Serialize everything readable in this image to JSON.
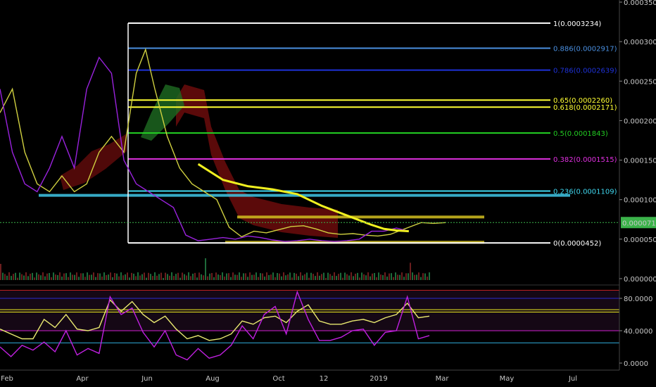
{
  "chart_data": [
    {
      "type": "line",
      "title": "",
      "xlabel": "",
      "ylabel": "",
      "x_ticks": [
        "Feb",
        "Apr",
        "Jun",
        "Aug",
        "Oct",
        "12",
        "2019",
        "Mar",
        "May",
        "Jul"
      ],
      "y_ticks": [
        "0.0000000",
        "0.0000500",
        "0.0001000",
        "0.0001500",
        "0.0002000",
        "0.0002500",
        "0.0003000",
        "0.0003500"
      ],
      "ylim": [
        0,
        0.00035
      ],
      "grid": false,
      "last_price": {
        "label": "0.0000710",
        "value": 7.1e-05,
        "color": "#3bb34a"
      },
      "fib_levels": [
        {
          "ratio": 1,
          "label": "1(0.0003234)",
          "value": 0.0003234,
          "color": "#ffffff"
        },
        {
          "ratio": 0.886,
          "label": "0.886(0.0002917)",
          "value": 0.0002917,
          "color": "#4a8fe0"
        },
        {
          "ratio": 0.786,
          "label": "0.786(0.0002639)",
          "value": 0.0002639,
          "color": "#1e32d8"
        },
        {
          "ratio": 0.65,
          "label": "0.65(0.0002260)",
          "value": 0.000226,
          "color": "#ffff33"
        },
        {
          "ratio": 0.618,
          "label": "0.618(0.0002171)",
          "value": 0.0002171,
          "color": "#ffff33"
        },
        {
          "ratio": 0.5,
          "label": "0.5(0.0001843)",
          "value": 0.0001843,
          "color": "#22cc22"
        },
        {
          "ratio": 0.382,
          "label": "0.382(0.0001515)",
          "value": 0.0001515,
          "color": "#e030e0"
        },
        {
          "ratio": 0.236,
          "label": "0.236(0.0001109)",
          "value": 0.0001109,
          "color": "#40d8f0"
        },
        {
          "ratio": 0,
          "label": "0(0.0000452)",
          "value": 4.52e-05,
          "color": "#ffffff"
        }
      ],
      "zones": [
        {
          "from": 0.0001037,
          "to": 0.0001072,
          "color": "#40c8e8"
        },
        {
          "from": 7.68e-05,
          "to": 7.98e-05,
          "color": "#d4c020"
        },
        {
          "from": 4.52e-05,
          "to": 4.78e-05,
          "color": "#d4c020"
        }
      ],
      "series": [
        {
          "color": "#d0d040",
          "x": [
            0,
            0.02,
            0.04,
            0.06,
            0.08,
            0.1,
            0.12,
            0.14,
            0.16,
            0.18,
            0.2,
            0.22,
            0.235,
            0.25,
            0.27,
            0.29,
            0.31,
            0.33,
            0.35,
            0.37,
            0.39,
            0.41,
            0.43,
            0.45,
            0.47,
            0.49,
            0.51,
            0.53,
            0.55,
            0.57,
            0.59,
            0.61,
            0.63,
            0.65,
            0.68,
            0.7,
            0.72
          ],
          "values": [
            0.00021,
            0.00024,
            0.00016,
            0.00012,
            0.00011,
            0.00013,
            0.00011,
            0.00012,
            0.00016,
            0.00018,
            0.00016,
            0.00026,
            0.00029,
            0.00024,
            0.00018,
            0.00014,
            0.00012,
            0.00011,
            0.0001,
            6.5e-05,
            5.3e-05,
            6e-05,
            5.8e-05,
            6.2e-05,
            6.6e-05,
            6.7e-05,
            6.3e-05,
            5.8e-05,
            5.6e-05,
            5.7e-05,
            5.5e-05,
            5.4e-05,
            5.6e-05,
            6.2e-05,
            7.1e-05,
            7e-05,
            7.1e-05
          ]
        },
        {
          "color": "#9922dd",
          "x": [
            0,
            0.02,
            0.04,
            0.06,
            0.08,
            0.1,
            0.12,
            0.14,
            0.16,
            0.18,
            0.2,
            0.22,
            0.24,
            0.26,
            0.28,
            0.3,
            0.32,
            0.34,
            0.36,
            0.38,
            0.4,
            0.42,
            0.44,
            0.46,
            0.48,
            0.5,
            0.52,
            0.54,
            0.56,
            0.58,
            0.6,
            0.62,
            0.64,
            0.66
          ],
          "values": [
            0.00024,
            0.00016,
            0.00012,
            0.00011,
            0.00014,
            0.00018,
            0.00014,
            0.00024,
            0.00028,
            0.00026,
            0.00015,
            0.00012,
            0.00011,
            0.0001,
            9e-05,
            5.5e-05,
            4.8e-05,
            5e-05,
            5.2e-05,
            5e-05,
            5.4e-05,
            5.2e-05,
            4.9e-05,
            4.7e-05,
            4.8e-05,
            5e-05,
            4.8e-05,
            4.7e-05,
            4.8e-05,
            5e-05,
            6e-05,
            6e-05,
            6.4e-05,
            6e-05
          ]
        },
        {
          "color": "#f0f020",
          "x": [
            0.32,
            0.36,
            0.4,
            0.44,
            0.48,
            0.52,
            0.56,
            0.6,
            0.62,
            0.64,
            0.66
          ],
          "values": [
            0.000145,
            0.000125,
            0.000117,
            0.000113,
            0.000107,
            9.2e-05,
            8e-05,
            6.8e-05,
            6.3e-05,
            6.1e-05,
            6e-05
          ]
        }
      ]
    },
    {
      "type": "line",
      "title": "",
      "y_ticks": [
        "0.0000",
        "40.0000",
        "80.0000"
      ],
      "ylim": [
        0,
        100
      ],
      "levels": [
        {
          "value": 90,
          "color": "#c02020"
        },
        {
          "value": 80,
          "color": "#2a2ad0"
        },
        {
          "value": 66,
          "color": "#f0f020"
        },
        {
          "value": 63,
          "color": "#f0f020"
        },
        {
          "value": 40,
          "color": "#d020d0"
        },
        {
          "value": 25,
          "color": "#30b0e0"
        }
      ],
      "series": [
        {
          "color": "#e8e870",
          "values": [
            42,
            36,
            30,
            30,
            54,
            44,
            60,
            42,
            40,
            44,
            78,
            64,
            76,
            60,
            50,
            58,
            42,
            30,
            34,
            28,
            30,
            36,
            52,
            48,
            56,
            58,
            50,
            64,
            72,
            52,
            48,
            48,
            52,
            54,
            50,
            56,
            60,
            74,
            56,
            58
          ]
        },
        {
          "color": "#c020e0",
          "values": [
            20,
            8,
            22,
            16,
            26,
            14,
            40,
            10,
            18,
            12,
            82,
            60,
            68,
            38,
            20,
            40,
            10,
            4,
            18,
            6,
            10,
            22,
            46,
            30,
            60,
            70,
            36,
            88,
            54,
            28,
            28,
            32,
            40,
            42,
            22,
            38,
            40,
            82,
            30,
            34
          ]
        }
      ]
    }
  ]
}
